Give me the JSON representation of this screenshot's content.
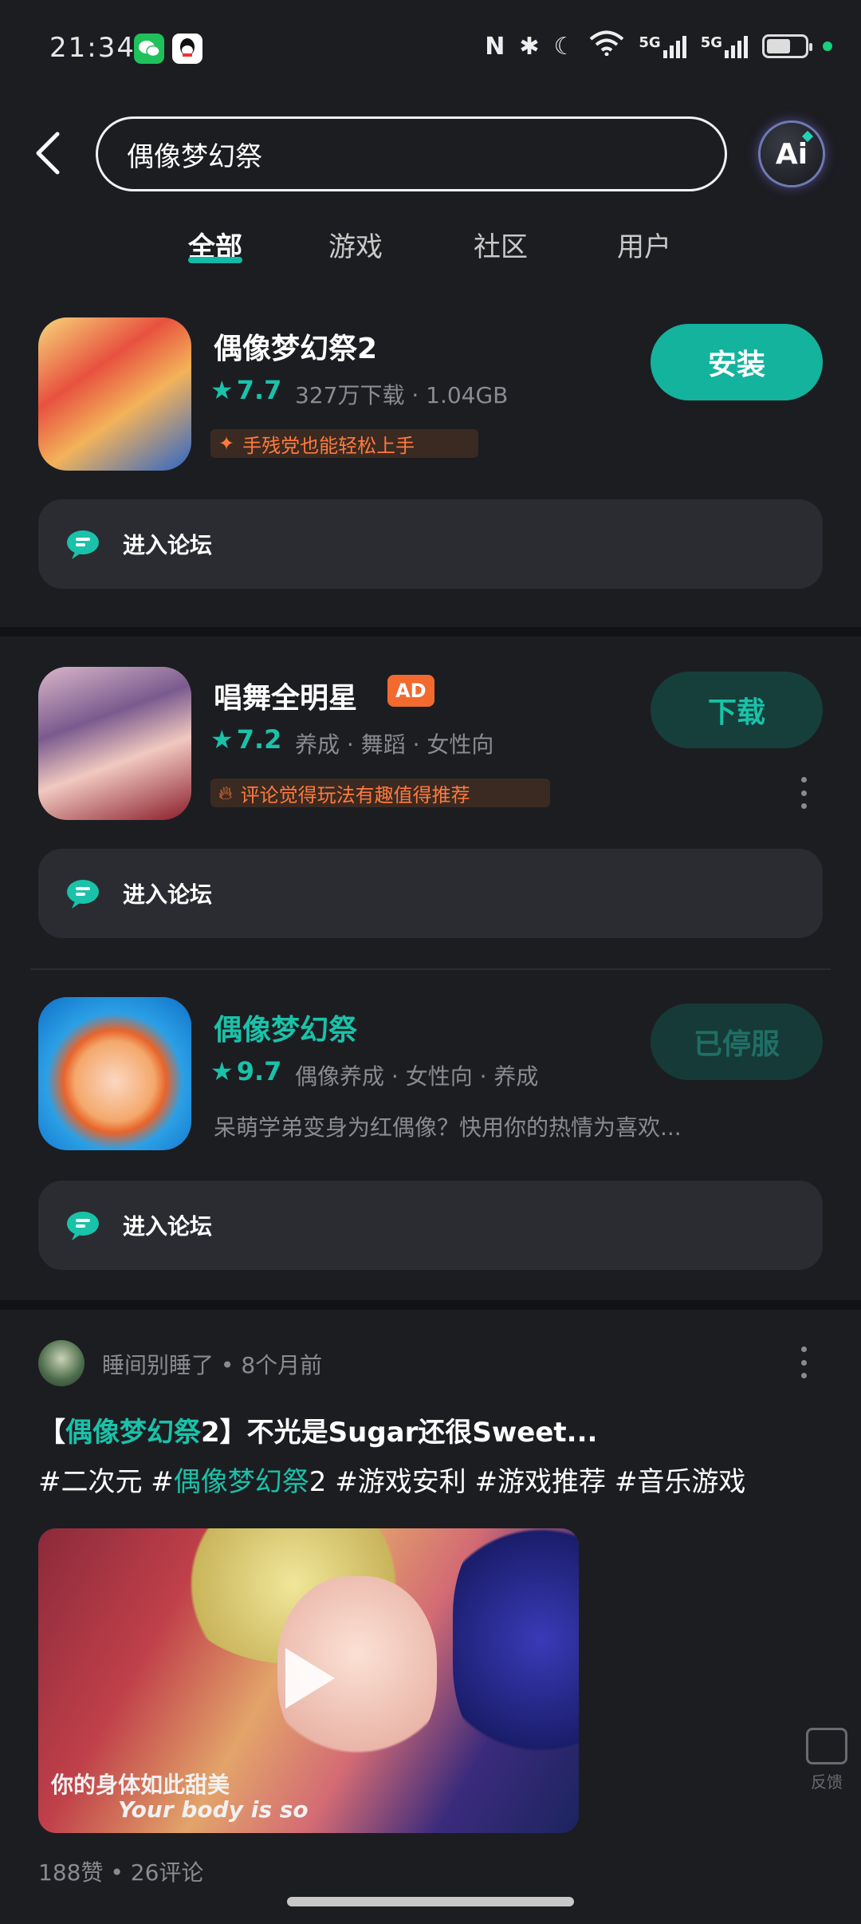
{
  "status_bar": {
    "time": "21:34",
    "icons": [
      "wechat-icon",
      "qq-icon",
      "nfc-icon",
      "bluetooth-icon",
      "moon-icon",
      "wifi-icon",
      "signal-5g-icon",
      "signal-5g-icon",
      "battery-icon"
    ],
    "net1": "5G",
    "net2": "5G"
  },
  "header": {
    "search_value": "偶像梦幻祭",
    "ai_label": "Ai"
  },
  "tabs": [
    {
      "label": "全部",
      "active": true
    },
    {
      "label": "游戏",
      "active": false
    },
    {
      "label": "社区",
      "active": false
    },
    {
      "label": "用户",
      "active": false
    }
  ],
  "results": [
    {
      "name": "偶像梦幻祭2",
      "rating": "7.7",
      "meta": "327万下载 · 1.04GB",
      "tag": "手残党也能轻松上手",
      "button": "安装",
      "forum": "进入论坛"
    },
    {
      "name": "唱舞全明星",
      "badge": "AD",
      "rating": "7.2",
      "meta": "养成 · 舞蹈 · 女性向",
      "tag": "评论觉得玩法有趣值得推荐",
      "button": "下载",
      "forum": "进入论坛"
    },
    {
      "name": "偶像梦幻祭",
      "rating": "9.7",
      "meta": "偶像养成 · 女性向 · 养成",
      "desc": "呆萌学弟变身为红偶像？快用你的热情为喜欢...",
      "button": "已停服",
      "forum": "进入论坛"
    }
  ],
  "post": {
    "author": "睡间别睡了",
    "time": "8个月前",
    "title_prefix": "【",
    "title_highlight": "偶像梦幻祭",
    "title_rest": "2】不光是Sugar还很Sweet...",
    "tags_1": "#二次元 #",
    "tags_highlight": "偶像梦幻祭",
    "tags_2": "2 #游戏安利 #游戏推荐 #音乐游戏",
    "subtitle_cn": "你的身体如此甜美",
    "subtitle_en": "Your body is so",
    "likes": "188赞",
    "comments": "26评论"
  },
  "feedback_label": "反馈",
  "colors": {
    "accent": "#13b39e",
    "background": "#1c1d21",
    "card": "#2b2c31",
    "tag_orange": "#ff7a3d",
    "ad_badge": "#f26a2e"
  }
}
